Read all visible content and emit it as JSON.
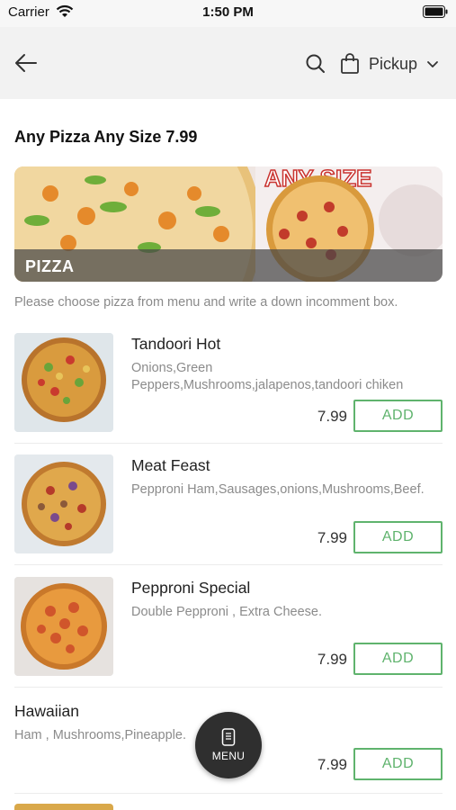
{
  "status_bar": {
    "carrier": "Carrier",
    "time": "1:50 PM"
  },
  "nav": {
    "pickup_label": "Pickup"
  },
  "deal": {
    "title": "Any Pizza Any Size 7.99",
    "banner_label": "PIZZA",
    "instructions": "Please choose pizza from menu and write a down incomment box."
  },
  "items": [
    {
      "name": "Tandoori Hot",
      "description": "Onions,Green Peppers,Mushrooms,jalapenos,tandoori chiken",
      "price": "7.99",
      "add_label": "ADD"
    },
    {
      "name": "Meat Feast",
      "description": "Pepproni Ham,Sausages,onions,Mushrooms,Beef.",
      "price": "7.99",
      "add_label": "ADD"
    },
    {
      "name": "Pepproni Special",
      "description": "Double Pepproni , Extra Cheese.",
      "price": "7.99",
      "add_label": "ADD"
    },
    {
      "name": "Hawaiian",
      "description": "Ham , Mushrooms,Pineapple.",
      "price": "7.99",
      "add_label": "ADD"
    }
  ],
  "fab": {
    "label": "MENU"
  },
  "colors": {
    "accent_green": "#5fb36d",
    "nav_bg": "#f2f2f2",
    "fab_bg": "#2f2f2f"
  },
  "icons": [
    "wifi-icon",
    "battery-icon",
    "back-arrow-icon",
    "search-icon",
    "shopping-bag-icon",
    "chevron-down-icon",
    "menu-phone-icon"
  ]
}
